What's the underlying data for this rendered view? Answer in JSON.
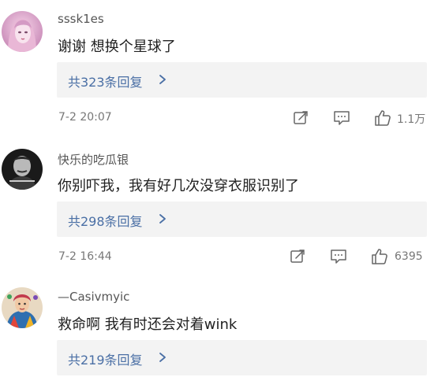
{
  "comments": [
    {
      "username": "sssk1es",
      "text": "谢谢 想换个星球了",
      "replies_label": "共323条回复",
      "time": "7-2 20:07",
      "likes": "1.1万",
      "avatar_icon": "anime-girl-portrait",
      "accent": "#4a6fa5"
    },
    {
      "username": "快乐的吃瓜银",
      "text": "你别吓我，我有好几次没穿衣服识别了",
      "replies_label": "共298条回复",
      "time": "7-2 16:44",
      "likes": "6395",
      "avatar_icon": "black-white-portrait"
    },
    {
      "username": "—Casivmyic",
      "text": "救命啊 我有时还会对着wink",
      "replies_label": "共219条回复",
      "avatar_icon": "colorful-portrait-illustration"
    }
  ],
  "icons": {
    "share": "share-icon",
    "comment": "comment-icon",
    "like": "thumbs-up-icon",
    "chevron": "chevron-right-icon"
  }
}
